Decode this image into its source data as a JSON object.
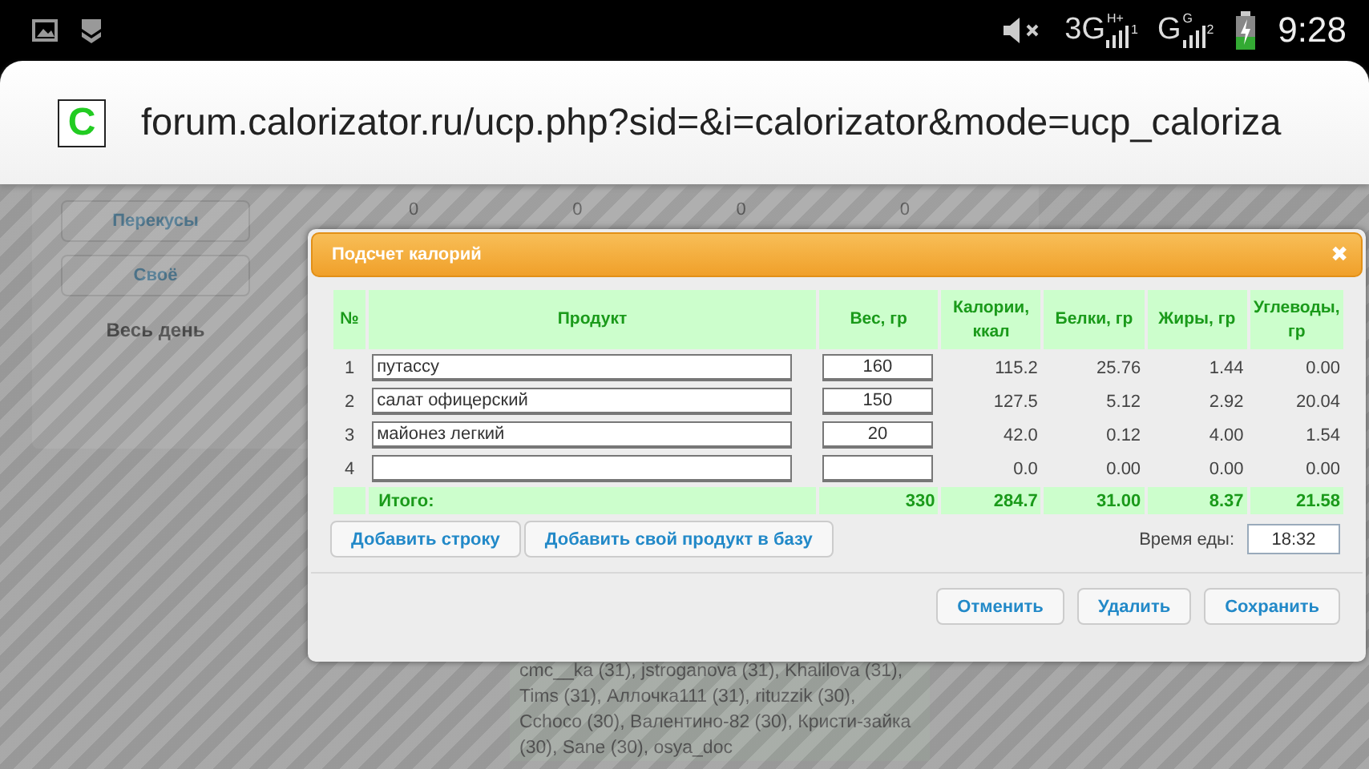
{
  "status_bar": {
    "signals": [
      {
        "network": "3G",
        "type": "H+",
        "sim": "1"
      },
      {
        "network": "G",
        "type": "G",
        "sim": "2"
      }
    ],
    "time": "9:28"
  },
  "address_bar": {
    "favicon": "C",
    "url": "forum.calorizator.ru/ucp.php?sid=&i=calorizator&mode=ucp_caloriza"
  },
  "background_page": {
    "meal_buttons": [
      "Перекусы",
      "Своё"
    ],
    "day_label": "Весь день",
    "zeros": [
      "0",
      "0",
      "0",
      "0"
    ],
    "users_text": "cmc__ka (31), jstroganova (31), Khalilova (31), Tims (31), Аллочка111 (31), rituzzik (30), Cchoco (30), Валентино-82 (30), Кристи-зайка (30), Sane (30), osya_doc"
  },
  "dialog": {
    "title": "Подсчет калорий",
    "close": "✖",
    "columns": [
      "№",
      "Продукт",
      "Вес, гр",
      "Калории, ккал",
      "Белки, гр",
      "Жиры, гр",
      "Углеводы, гр"
    ],
    "rows": [
      {
        "num": "1",
        "product": "путассу",
        "weight": "160",
        "calories": "115.2",
        "protein": "25.76",
        "fat": "1.44",
        "carbs": "0.00"
      },
      {
        "num": "2",
        "product": "салат офицерский",
        "weight": "150",
        "calories": "127.5",
        "protein": "5.12",
        "fat": "2.92",
        "carbs": "20.04"
      },
      {
        "num": "3",
        "product": "майонез легкий",
        "weight": "20",
        "calories": "42.0",
        "protein": "0.12",
        "fat": "4.00",
        "carbs": "1.54"
      },
      {
        "num": "4",
        "calories": "0.0",
        "protein": "0.00",
        "fat": "0.00",
        "carbs": "0.00"
      }
    ],
    "totals": {
      "label": "Итого:",
      "weight": "330",
      "calories": "284.7",
      "protein": "31.00",
      "fat": "8.37",
      "carbs": "21.58"
    },
    "add_buttons": [
      "Добавить строку",
      "Добавить свой продукт в базу"
    ],
    "meal_time": {
      "label": "Время еды:",
      "value": "18:32"
    },
    "footer_buttons": [
      "Отменить",
      "Удалить",
      "Сохранить"
    ]
  }
}
